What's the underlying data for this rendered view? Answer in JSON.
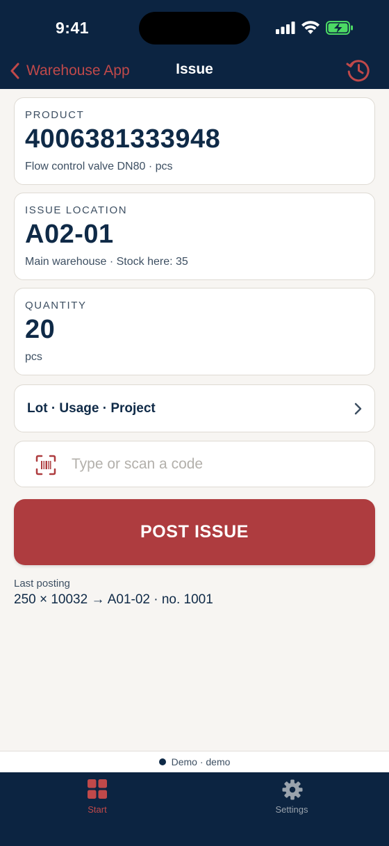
{
  "status_bar": {
    "time": "9:41"
  },
  "nav": {
    "back_label": "Warehouse App",
    "title": "Issue",
    "history_icon": "history-icon"
  },
  "product": {
    "label": "PRODUCT",
    "value": "4006381333948",
    "subtitle": "Flow control valve DN80 · pcs"
  },
  "location": {
    "label": "ISSUE LOCATION",
    "value": "A02-01",
    "subtitle": "Main warehouse · Stock here: 35"
  },
  "quantity": {
    "label": "QUANTITY",
    "value": "20",
    "unit": "pcs"
  },
  "details_row": {
    "label": "Lot · Usage · Project"
  },
  "scan": {
    "placeholder": "Type or scan a code",
    "value": ""
  },
  "post_button": {
    "label": "POST ISSUE"
  },
  "last_posting": {
    "label": "Last posting",
    "value": "250 × 10032 → A01-02 · no. 1001"
  },
  "environment": {
    "text": "Demo · demo"
  },
  "tabs": [
    {
      "label": "Start",
      "icon": "grid-icon",
      "active": true
    },
    {
      "label": "Settings",
      "icon": "gear-icon",
      "active": false
    }
  ],
  "colors": {
    "navy": "#0c2441",
    "accent_red": "#ae3c3f",
    "link_red": "#c0494a",
    "battery_green": "#4cd964",
    "background": "#f7f5f2"
  }
}
